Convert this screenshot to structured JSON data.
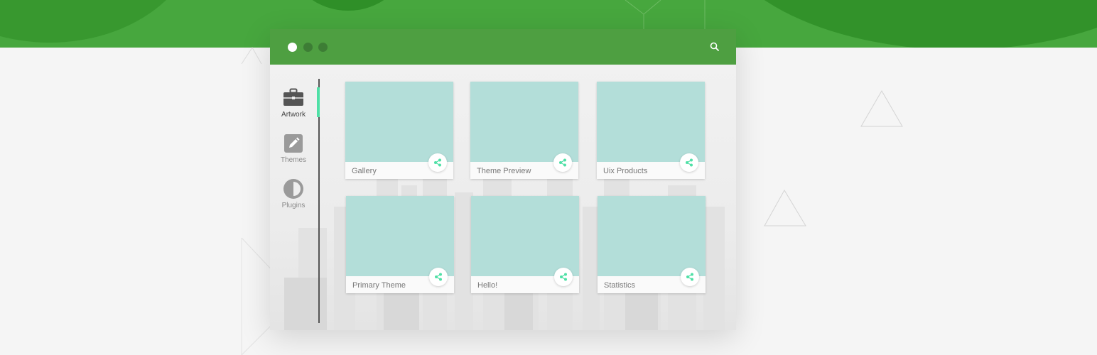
{
  "colors": {
    "brand_green": "#4e9f41",
    "accent": "#4fe0a6",
    "thumb": "#b3ded9"
  },
  "window": {
    "controls": [
      "close-dot",
      "minimize-dot",
      "maximize-dot"
    ],
    "search_icon": "search-icon"
  },
  "sidebar": {
    "items": [
      {
        "label": "Artwork",
        "icon": "briefcase-icon",
        "active": true
      },
      {
        "label": "Themes",
        "icon": "pencil-icon",
        "active": false
      },
      {
        "label": "Plugins",
        "icon": "half-circle-icon",
        "active": false
      }
    ]
  },
  "cards": [
    {
      "label": "Gallery",
      "icon": "share-icon"
    },
    {
      "label": "Theme Preview",
      "icon": "share-icon"
    },
    {
      "label": "Uix Products",
      "icon": "share-icon"
    },
    {
      "label": "Primary Theme",
      "icon": "share-icon"
    },
    {
      "label": "Hello!",
      "icon": "share-icon"
    },
    {
      "label": "Statistics",
      "icon": "share-icon"
    }
  ]
}
